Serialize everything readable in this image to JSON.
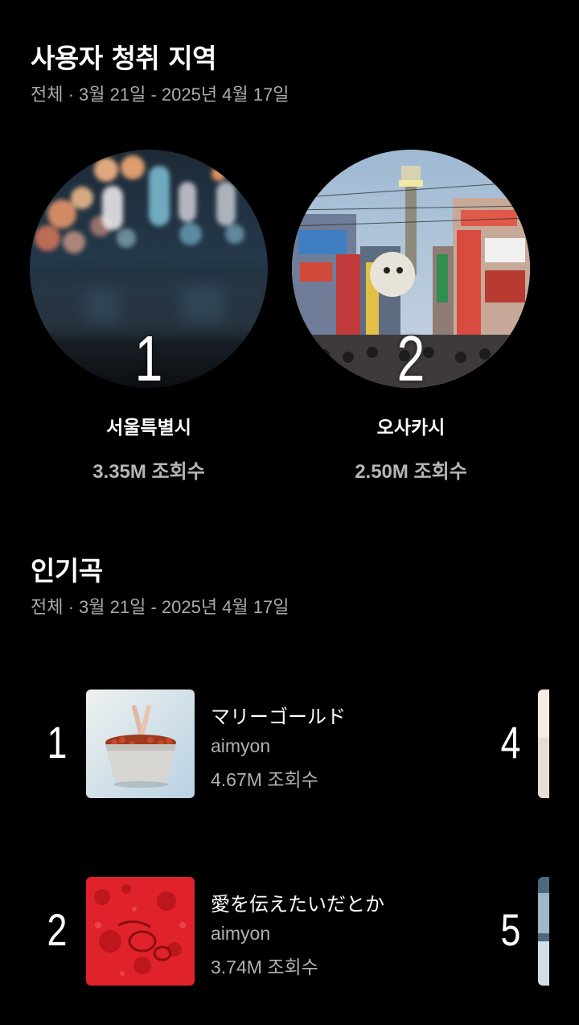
{
  "regions": {
    "title": "사용자 청취 지역",
    "subtitle": "전체 · 3월 21일 - 2025년 4월 17일",
    "items": [
      {
        "rank": "1",
        "name": "서울특별시",
        "views": "3.35M 조회수",
        "image": "bokeh-night-city-photo"
      },
      {
        "rank": "2",
        "name": "오사카시",
        "views": "2.50M 조회수",
        "image": "osaka-tsutenkaku-street-photo"
      }
    ]
  },
  "top_songs": {
    "title": "인기곡",
    "subtitle": "전체 · 3월 21일 - 2025년 4월 17일",
    "items": [
      {
        "rank": "1",
        "title": "マリーゴールド",
        "artist": "aimyon",
        "views": "4.67M 조회수",
        "art": "hands-in-flowerpot-artwork"
      },
      {
        "rank": "2",
        "title": "愛を伝えたいだとか",
        "artist": "aimyon",
        "views": "3.74M 조회수",
        "art": "red-textured-artwork"
      }
    ],
    "partial_items": [
      {
        "rank": "4"
      },
      {
        "rank": "5"
      }
    ]
  }
}
